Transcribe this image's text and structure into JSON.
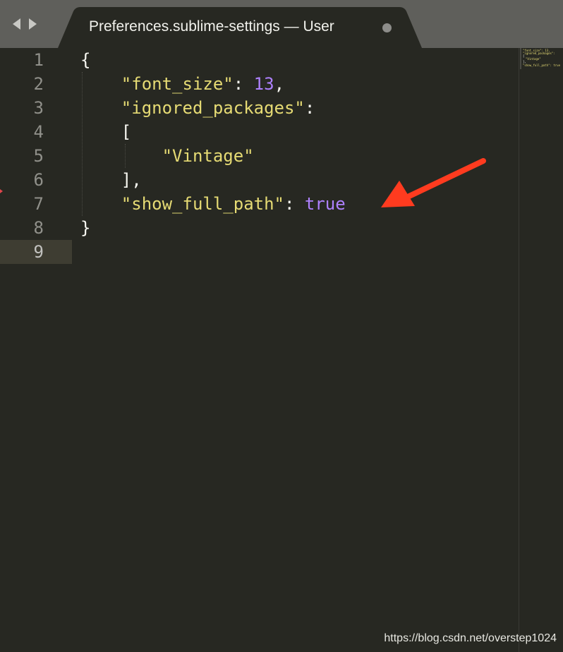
{
  "tab": {
    "title": "Preferences.sublime-settings — User",
    "dirty_indicator": "unsaved-dot"
  },
  "nav": {
    "back_icon": "chevron-left-icon",
    "forward_icon": "chevron-right-icon"
  },
  "editor": {
    "current_line": 9,
    "line_numbers": [
      "1",
      "2",
      "3",
      "4",
      "5",
      "6",
      "7",
      "8",
      "9"
    ],
    "lines": [
      {
        "t1": "{"
      },
      {
        "indent": "    ",
        "key": "\"font_size\"",
        "sep": ": ",
        "value": "13",
        "tail": ","
      },
      {
        "indent": "    ",
        "key": "\"ignored_packages\"",
        "tail": ":"
      },
      {
        "indent": "    ",
        "t1": "["
      },
      {
        "indent": "        ",
        "str": "\"Vintage\""
      },
      {
        "indent": "    ",
        "t1": "],"
      },
      {
        "indent": "    ",
        "key": "\"show_full_path\"",
        "sep": ": ",
        "value": "true"
      },
      {
        "t1": "}"
      },
      {
        "t1": ""
      }
    ]
  },
  "minimap": {
    "lines": [
      "\"font_size\": 13,",
      "\"ignored_packages\":",
      "[",
      "\"Vintage\"",
      "],",
      "\"show_full_path\": true"
    ]
  },
  "annotation": {
    "type": "arrow",
    "color": "#ff3b1f",
    "points_to": "show_full_path true"
  },
  "watermark": "https://blog.csdn.net/overstep1024",
  "colors": {
    "background": "#272822",
    "tabbar": "#5f5f5b",
    "string": "#e6db74",
    "constant": "#ae81ff",
    "text": "#f8f8f2",
    "line_number": "#90908a",
    "current_line": "#3e3d32"
  }
}
